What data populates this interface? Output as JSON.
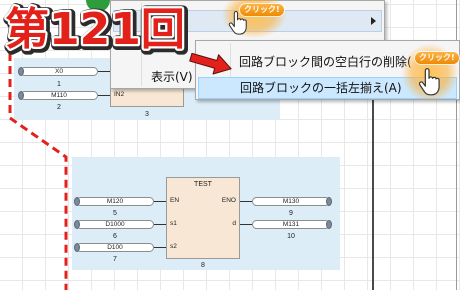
{
  "title_badge": {
    "text": "第121回"
  },
  "click_badges": [
    {
      "label": "クリック!"
    },
    {
      "label": "クリック!"
    }
  ],
  "context_menu": {
    "items": [
      {
        "label": "表示(V)"
      }
    ]
  },
  "submenu": {
    "items": [
      {
        "label": "回路ブロック間の空白行の削除(",
        "highlighted": false
      },
      {
        "label": "回路ブロックの一括左揃え(A)",
        "highlighted": true
      }
    ]
  },
  "editor": {
    "block_1": {
      "inputs": [
        {
          "device": "X0",
          "number": "1"
        },
        {
          "device": "M110",
          "number": "2"
        }
      ],
      "function_block": {
        "input_pins": [
          "IN2"
        ],
        "number": "3"
      }
    },
    "block_2": {
      "inputs": [
        {
          "device": "M120",
          "number": "5"
        },
        {
          "device": "D1000",
          "number": "6"
        },
        {
          "device": "D100",
          "number": "7"
        }
      ],
      "function_block": {
        "name": "TEST",
        "number": "8",
        "input_pins": [
          "EN",
          "s1",
          "s2"
        ],
        "output_pins": [
          "ENO",
          "d"
        ]
      },
      "outputs": [
        {
          "device": "M130",
          "number": "9"
        },
        {
          "device": "M131",
          "number": "10"
        }
      ]
    }
  },
  "icons": {
    "submenu_arrow": "chevron-right-icon",
    "cursor": "hand-pointer-icon",
    "pointer": "red-arrow-icon",
    "connector": "connector-dot-icon"
  },
  "colors": {
    "accent_red": "#e3211b",
    "menu_highlight": "#cce8ff",
    "block_area": "#dcedf8",
    "function_block_fill": "#f7e7d4",
    "click_badge": "#f39a1e",
    "decorative_green": "#2e9b3c"
  }
}
